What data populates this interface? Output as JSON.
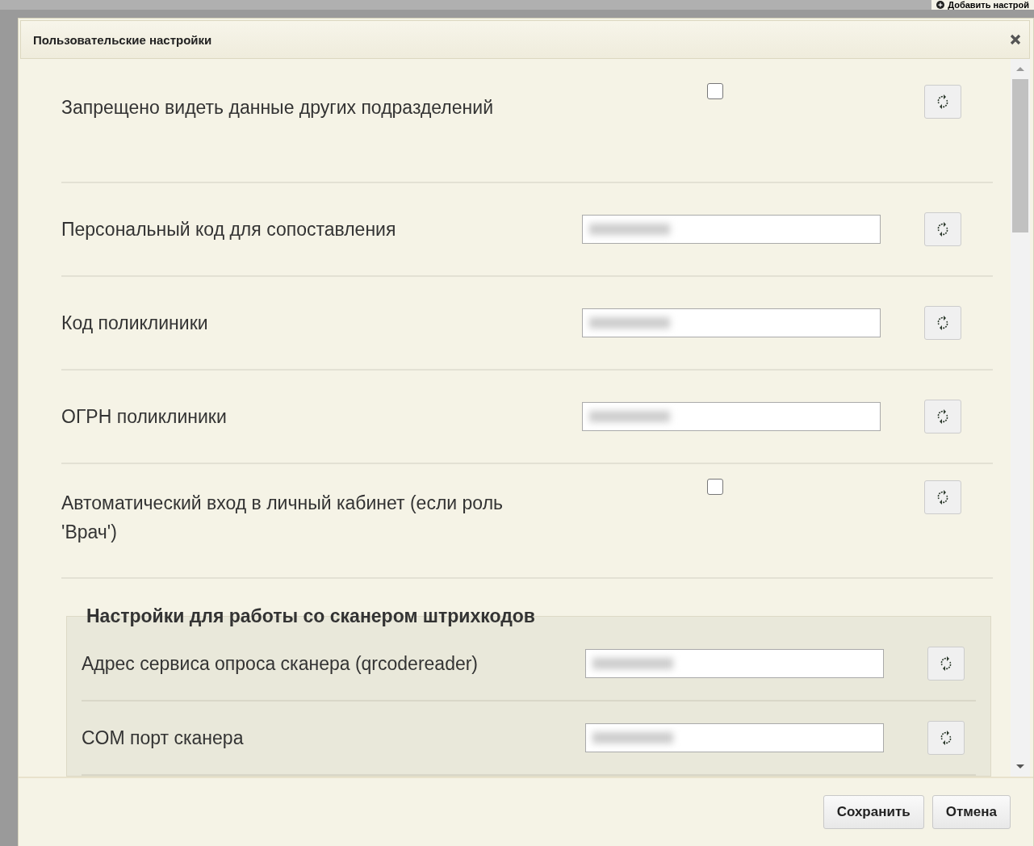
{
  "top_button": {
    "label": "Добавить настрой"
  },
  "dialog": {
    "title": "Пользовательские настройки",
    "settings": [
      {
        "kind": "checkbox",
        "label": "Запрещено видеть данные других подразделений",
        "checked": false
      },
      {
        "kind": "text",
        "label": "Персональный код для сопоставления"
      },
      {
        "kind": "text",
        "label": "Код поликлиники"
      },
      {
        "kind": "text",
        "label": "ОГРН поликлиники"
      },
      {
        "kind": "checkbox",
        "label": "Автоматический вход в личный кабинет (если роль 'Врач')",
        "checked": false
      }
    ],
    "group": {
      "legend": "Настройки для работы со сканером штрихкодов",
      "settings": [
        {
          "kind": "text",
          "label": "Адрес сервиса опроса сканера (qrcodereader)"
        },
        {
          "kind": "text",
          "label": "COM порт сканера"
        }
      ]
    },
    "buttons": [
      {
        "label": "Сохранить"
      },
      {
        "label": "Отмена"
      }
    ]
  }
}
